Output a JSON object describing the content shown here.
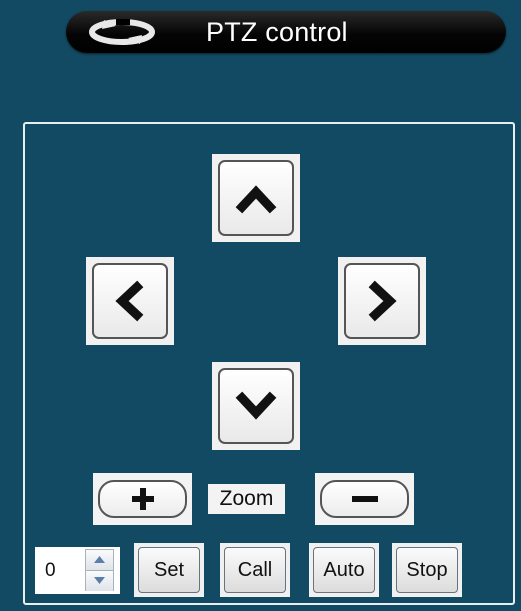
{
  "header": {
    "title": "PTZ control",
    "logo_icon": "rotate-arrows-icon"
  },
  "directions": {
    "up_icon": "chevron-up-icon",
    "left_icon": "chevron-left-icon",
    "right_icon": "chevron-right-icon",
    "down_icon": "chevron-down-icon"
  },
  "zoom": {
    "label": "Zoom",
    "in_icon": "plus-icon",
    "out_icon": "minus-icon"
  },
  "preset": {
    "value": "0",
    "set_label": "Set",
    "call_label": "Call",
    "auto_label": "Auto",
    "stop_label": "Stop"
  },
  "colors": {
    "background": "#124a63",
    "header_bg": "#000000",
    "button_face": "#f1f1f1",
    "panel_border": "#e9eef0"
  }
}
